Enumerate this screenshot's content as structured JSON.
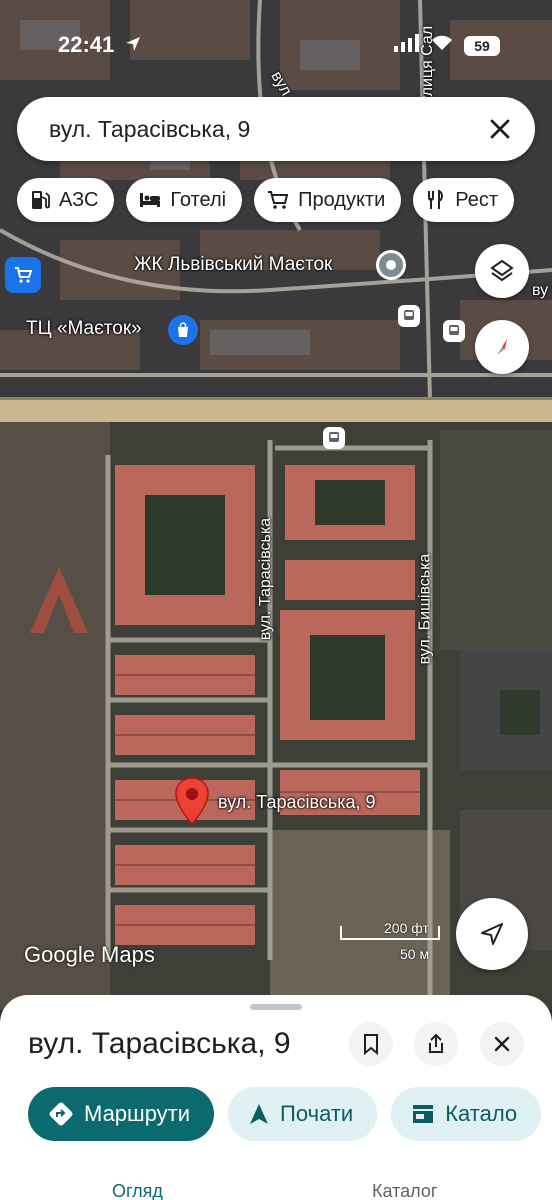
{
  "status_bar": {
    "time": "22:41",
    "battery": "59"
  },
  "search": {
    "query": "вул. Тарасівська, 9"
  },
  "chips": [
    {
      "label": "АЗС",
      "icon": "gas-station-icon"
    },
    {
      "label": "Готелі",
      "icon": "hotel-bed-icon"
    },
    {
      "label": "Продукти",
      "icon": "shopping-cart-icon"
    },
    {
      "label": "Рест",
      "icon": "restaurant-icon"
    }
  ],
  "map": {
    "poi": {
      "complex": "ЖК Львівський Маєток",
      "mall": "ТЦ «Маєток»",
      "pin_label": "вул. Тарасівська, 9"
    },
    "streets": {
      "tarasivska": "вул. Тарасівська",
      "bishivska": "вул. Бишівська",
      "top_vul": "вул",
      "top_right": "вулиця Сал",
      "edge_vu": "ву"
    },
    "attribution": "Google Maps",
    "scale_ft": "200 фт",
    "scale_m": "50 м"
  },
  "sheet": {
    "title": "вул. Тарасівська, 9",
    "actions": [
      {
        "label": "Маршрути"
      },
      {
        "label": "Почати"
      },
      {
        "label": "Катало"
      }
    ],
    "tabs": [
      "Огляд",
      "Каталог"
    ]
  },
  "colors": {
    "accent": "#0b6a6e",
    "pin": "#ea4335",
    "secondary_bg": "#e0f1f3"
  }
}
